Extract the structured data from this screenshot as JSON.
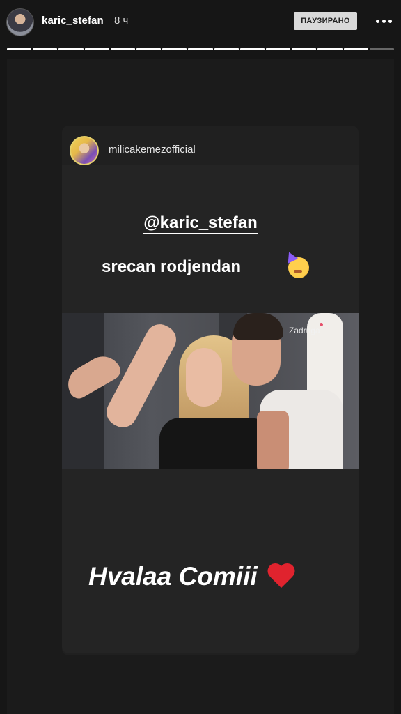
{
  "header": {
    "username": "karic_stefan",
    "time": "8 ч",
    "status_badge": "ПАУЗИРАНО",
    "more_icon": "more-horizontal-icon"
  },
  "progress": {
    "segments": 15,
    "completed": 14,
    "current_fraction": 0
  },
  "shared_post": {
    "username": "milicakemezofficial",
    "mention": "@karic_stefan",
    "birthday_text": "srecan rodjendan",
    "birthday_emoji": "party-face-icon",
    "video_watermark": "Zadruga"
  },
  "caption": {
    "text": "Hvalaa Comiii",
    "emoji": "heart-icon"
  },
  "colors": {
    "background": "#161616",
    "heart": "#e0232e",
    "badge_bg": "#d9d9d9"
  }
}
